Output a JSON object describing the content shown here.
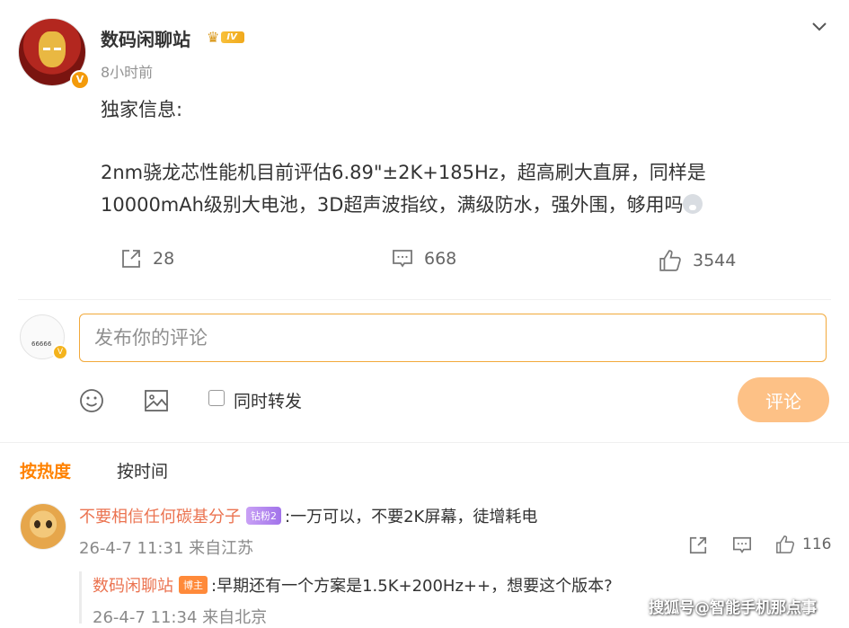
{
  "post": {
    "author": "数码闲聊站",
    "level_badge": "IV",
    "verified_badge": "V",
    "time": "8小时前",
    "content_line1": "独家信息:",
    "content_line2": "2nm骁龙芯性能机目前评估6.89\"±2K+185Hz，超高刷大直屏，同样是",
    "content_line3": "10000mAh级别大电池，3D超声波指纹，满级防水，强外围，够用吗",
    "stats": {
      "reposts": "28",
      "comments": "668",
      "likes": "3544"
    }
  },
  "composer": {
    "placeholder": "发布你的评论",
    "repost_checkbox_label": "同时转发",
    "submit_label": "评论",
    "avatar_tag": "66666"
  },
  "sort_tabs": {
    "hot": "按热度",
    "time": "按时间"
  },
  "comment": {
    "user": "不要相信任何碳基分子",
    "fan_badge": "钻粉2",
    "text": ":一万可以，不要2K屏幕，徒增耗电",
    "meta": "26-4-7 11:31 来自江苏",
    "likes": "116"
  },
  "reply": {
    "user": "数码闲聊站",
    "badge": "博主",
    "text": ":早期还有一个方案是1.5K+200Hz++，想要这个版本?",
    "meta": "26-4-7 11:34 来自北京"
  },
  "watermark": "搜狐号@智能手机那点事",
  "colors": {
    "accent": "#ff8200",
    "username_link": "#eb7350",
    "input_border": "#f2a93b",
    "submit_bg": "#fdc186"
  },
  "icons": [
    "chevron-down-icon",
    "repost-icon",
    "comment-icon",
    "like-icon",
    "emoji-icon",
    "image-icon"
  ]
}
